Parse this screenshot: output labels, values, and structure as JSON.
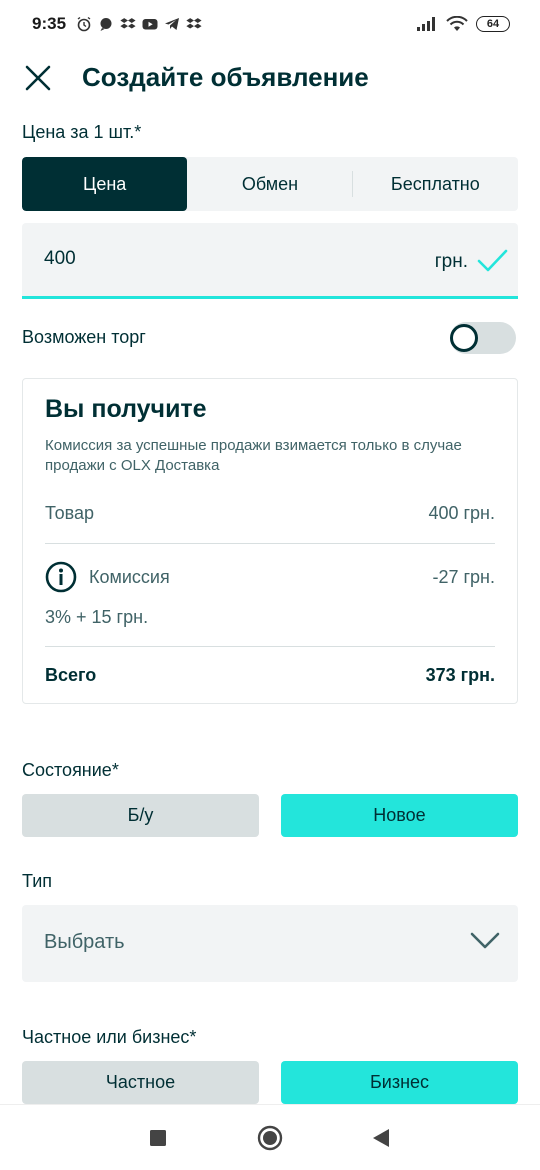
{
  "status_bar": {
    "time": "9:35",
    "battery": "64"
  },
  "header": {
    "title": "Создайте объявление"
  },
  "price": {
    "label": "Цена за 1 шт.*",
    "options": [
      "Цена",
      "Обмен",
      "Бесплатно"
    ],
    "selected_option": "Цена",
    "value": "400",
    "unit": "грн."
  },
  "negotiable": {
    "label": "Возможен торг",
    "enabled": false
  },
  "receive": {
    "title": "Вы получите",
    "note": "Комиссия за успешные продажи взимается только в случае продажи с OLX Доставка",
    "item_label": "Товар",
    "item_value": "400 грн.",
    "commission_label": "Комиссия",
    "commission_value": "-27 грн.",
    "commission_formula": "3% + 15 грн.",
    "total_label": "Всего",
    "total_value": "373 грн."
  },
  "condition": {
    "label": "Состояние*",
    "options": [
      "Б/у",
      "Новое"
    ],
    "selected": "Новое"
  },
  "type": {
    "label": "Тип",
    "placeholder": "Выбрать"
  },
  "seller_type": {
    "label": "Частное или бизнес*",
    "options": [
      "Частное",
      "Бизнес"
    ],
    "selected": "Бизнес"
  },
  "colors": {
    "primary": "#002f34",
    "accent": "#23e5db",
    "surface": "#f2f4f5",
    "muted": "#d8dfe0"
  }
}
